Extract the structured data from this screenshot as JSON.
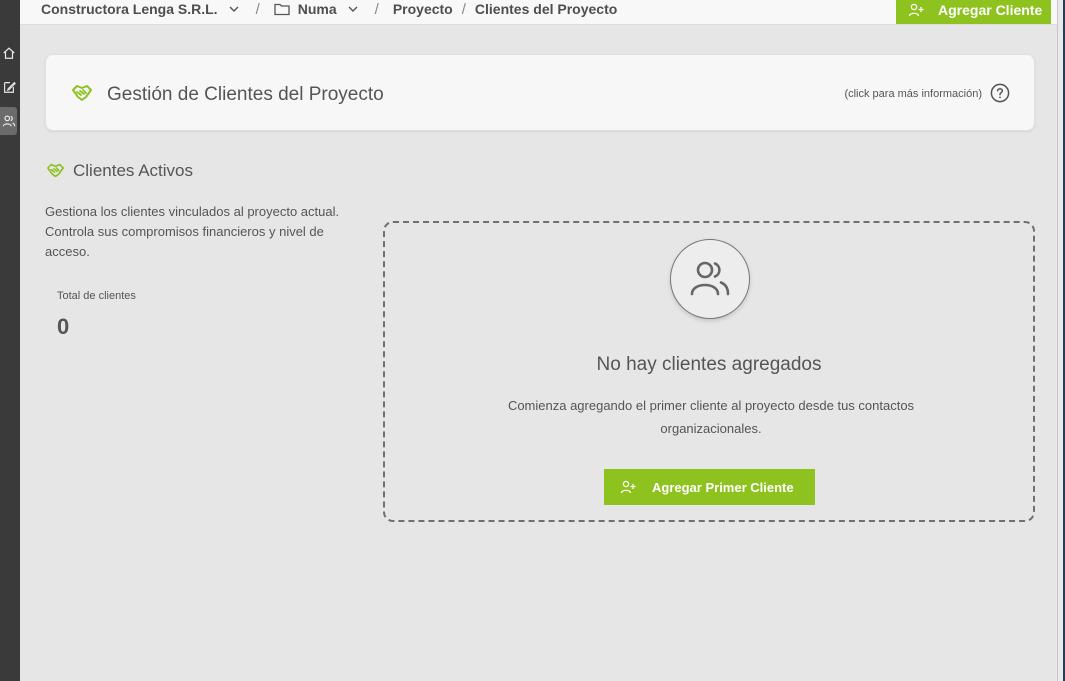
{
  "sidebar": {
    "icons": [
      "home-icon",
      "edit-icon",
      "users-icon"
    ]
  },
  "breadcrumb": {
    "organization": "Constructora Lenga S.R.L.",
    "separator": "/",
    "folder": "Numa",
    "project": "Proyecto",
    "current": "Clientes del Proyecto"
  },
  "top_action": {
    "label": "Agregar Cliente",
    "icon": "user-plus-icon"
  },
  "header": {
    "title": "Gestión de Clientes del Proyecto",
    "info_link": "(click para más información)",
    "icon": "handshake-icon"
  },
  "section": {
    "title": "Clientes Activos",
    "description": "Gestiona los clientes vinculados al proyecto actual. Controla sus compromisos financieros y nivel de acceso.",
    "stat_label": "Total de clientes",
    "stat_value": "0"
  },
  "empty_state": {
    "title": "No hay clientes agregados",
    "text": "Comienza agregando el primer cliente al proyecto desde tus contactos organizacionales.",
    "button_label": "Agregar Primer Cliente"
  },
  "colors": {
    "accent": "#8dc21f",
    "sidebar": "#3a3a3a",
    "background": "#e6e6e6"
  }
}
